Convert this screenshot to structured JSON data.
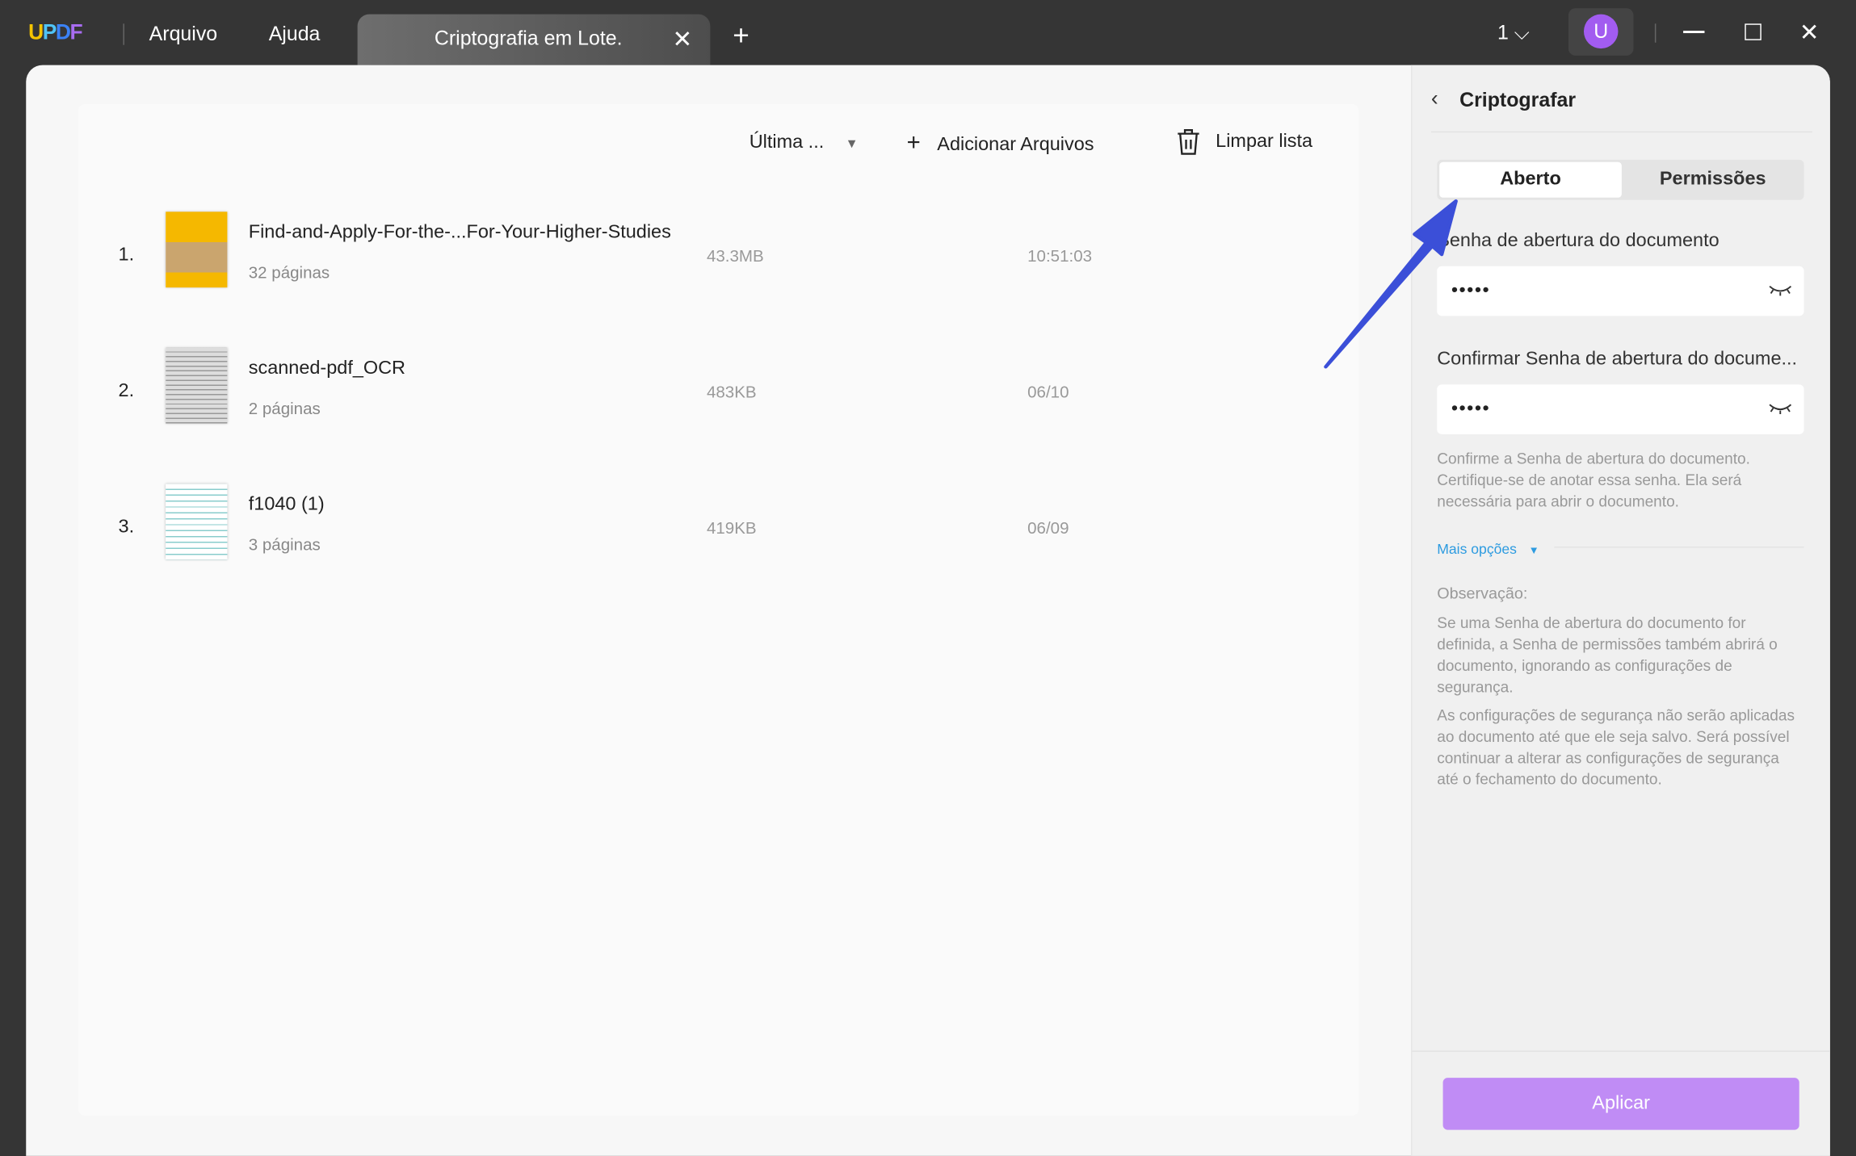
{
  "titlebar": {
    "logo": "UPDF",
    "menu": [
      "Arquivo",
      "Ajuda"
    ],
    "tab_title": "Criptografia em Lote.",
    "window_count": "1",
    "avatar_letter": "U"
  },
  "toolbar": {
    "sort": "Última ...",
    "add_files": "Adicionar Arquivos",
    "clear_list": "Limpar lista"
  },
  "files": [
    {
      "index": "1.",
      "name": "Find-and-Apply-For-the-...For-Your-Higher-Studies",
      "pages": "32 páginas",
      "size": "43.3MB",
      "time": "10:51:03"
    },
    {
      "index": "2.",
      "name": "scanned-pdf_OCR",
      "pages": "2 páginas",
      "size": "483KB",
      "time": "06/10"
    },
    {
      "index": "3.",
      "name": "f1040 (1)",
      "pages": "3 páginas",
      "size": "419KB",
      "time": "06/09"
    }
  ],
  "panel": {
    "title": "Criptografar",
    "tabs": [
      "Aberto",
      "Permissões"
    ],
    "open_pw_label": "Senha de abertura do documento",
    "open_pw_value": "•••••",
    "confirm_label": "Confirmar Senha de abertura do docume...",
    "confirm_value": "•••••",
    "help": "Confirme a Senha de abertura do documento. Certifique-se de anotar essa senha. Ela será necessária para abrir o documento.",
    "more_options": "Mais opções",
    "note_title": "Observação:",
    "note_1": "Se uma Senha de abertura do documento for definida, a Senha de permissões também abrirá o documento, ignorando as configurações de segurança.",
    "note_2": "As configurações de segurança não serão aplicadas ao documento até que ele seja salvo. Será possível continuar a alterar as configurações de segurança até o fechamento do documento.",
    "apply": "Aplicar"
  },
  "colors": {
    "accent": "#c08cf5",
    "arrow": "#3b4fd8",
    "link": "#2d9be0"
  }
}
